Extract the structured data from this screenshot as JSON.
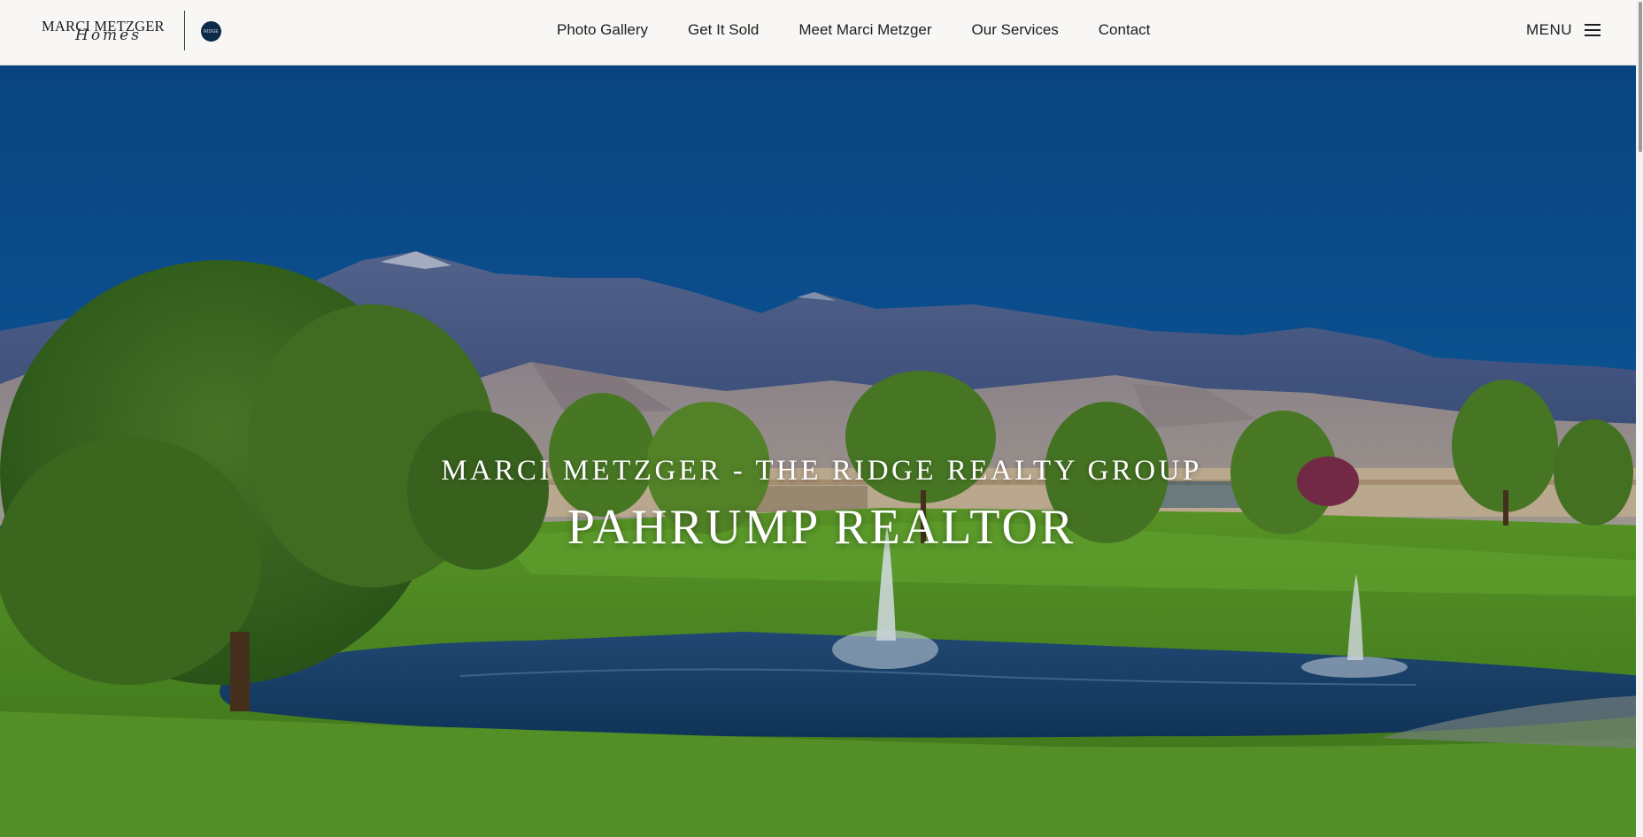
{
  "header": {
    "logo": {
      "main": "MARCI METZGER",
      "script": "Homes",
      "badge": "RIDGE"
    },
    "nav": [
      {
        "label": "Photo Gallery"
      },
      {
        "label": "Get It Sold"
      },
      {
        "label": "Meet Marci Metzger"
      },
      {
        "label": "Our Services"
      },
      {
        "label": "Contact"
      }
    ],
    "menu_label": "MENU"
  },
  "hero": {
    "subtitle": "MARCI METZGER - THE RIDGE REALTY GROUP",
    "title": "PAHRUMP REALTOR"
  },
  "colors": {
    "header_bg": "#f8f7f5",
    "sky": "#0d4f8f",
    "grass": "#5e9d2c",
    "water": "#1f4f7e",
    "badge": "#0d2a48"
  }
}
